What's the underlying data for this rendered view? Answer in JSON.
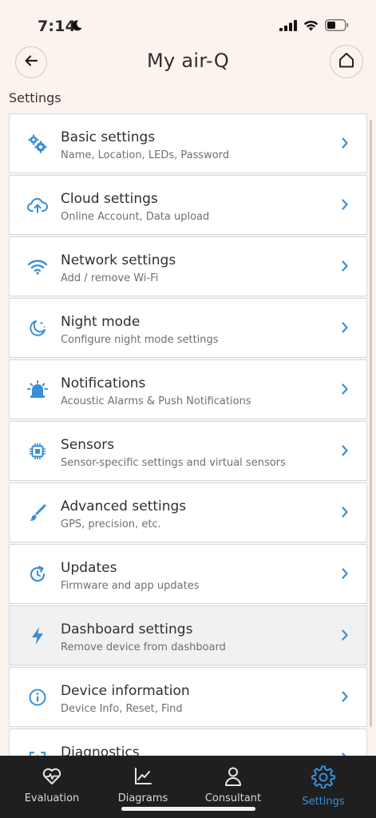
{
  "status": {
    "time": "7:14"
  },
  "header": {
    "title": "My air-Q"
  },
  "section_label": "Settings",
  "colors": {
    "accent": "#3a8fd6",
    "background": "#fdf3ee",
    "tabbar": "#1f1f1f"
  },
  "items": [
    {
      "title": "Basic settings",
      "subtitle": "Name, Location, LEDs, Password",
      "icon": "gears-icon"
    },
    {
      "title": "Cloud settings",
      "subtitle": "Online Account, Data upload",
      "icon": "cloud-upload-icon"
    },
    {
      "title": "Network settings",
      "subtitle": "Add / remove Wi-Fi",
      "icon": "wifi-icon"
    },
    {
      "title": "Night mode",
      "subtitle": "Configure night mode settings",
      "icon": "moon-icon"
    },
    {
      "title": "Notifications",
      "subtitle": "Acoustic Alarms & Push Notifications",
      "icon": "alarm-bell-icon"
    },
    {
      "title": "Sensors",
      "subtitle": "Sensor-specific settings and virtual sensors",
      "icon": "chip-icon"
    },
    {
      "title": "Advanced settings",
      "subtitle": "GPS, precision, etc.",
      "icon": "brush-icon"
    },
    {
      "title": "Updates",
      "subtitle": "Firmware and app updates",
      "icon": "update-icon"
    },
    {
      "title": "Dashboard settings",
      "subtitle": "Remove device from dashboard",
      "icon": "bolt-icon"
    },
    {
      "title": "Device information",
      "subtitle": "Device Info, Reset, Find",
      "icon": "info-icon"
    },
    {
      "title": "Diagnostics",
      "subtitle": "",
      "icon": "diagnostics-icon"
    }
  ],
  "tabs": [
    {
      "label": "Evaluation",
      "icon": "heart-pulse-icon"
    },
    {
      "label": "Diagrams",
      "icon": "line-chart-icon"
    },
    {
      "label": "Consultant",
      "icon": "person-icon"
    },
    {
      "label": "Settings",
      "icon": "gear-icon",
      "active": true
    }
  ]
}
